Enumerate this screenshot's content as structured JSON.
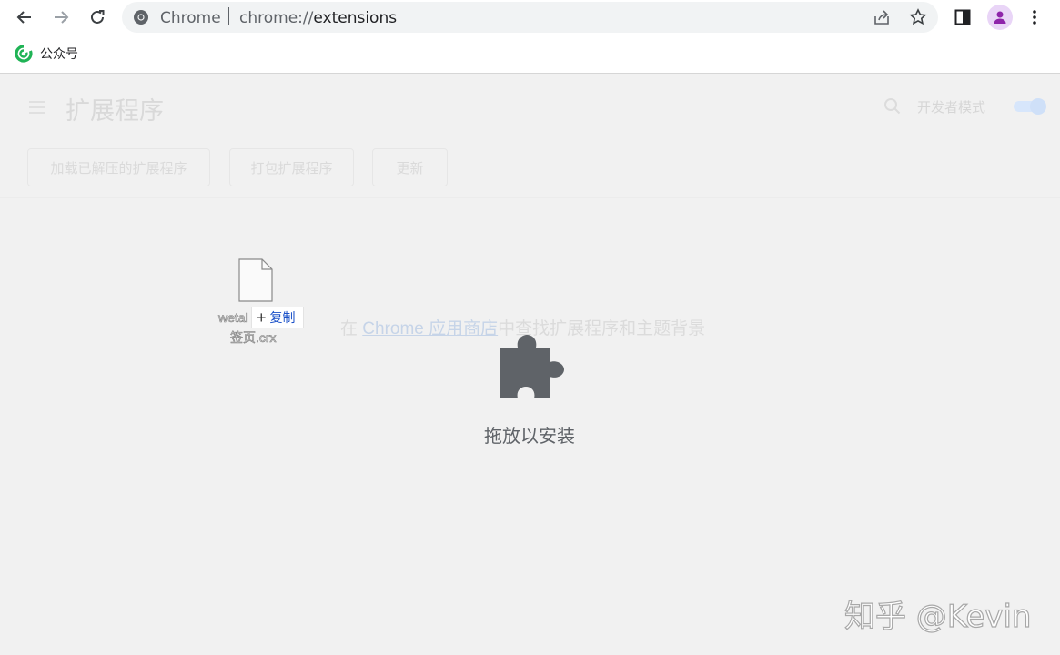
{
  "browser": {
    "omnibox": {
      "host": "Chrome",
      "url_prefix": "chrome://",
      "url_path": "extensions"
    },
    "bookmarks": [
      {
        "label": "公众号"
      }
    ]
  },
  "extensions_page": {
    "title": "扩展程序",
    "developer_mode_label": "开发者模式",
    "developer_mode_on": true,
    "buttons": {
      "load_unpacked": "加载已解压的扩展程序",
      "pack": "打包扩展程序",
      "update": "更新"
    },
    "store_prefix": "在 ",
    "store_link": "Chrome 应用商店",
    "store_suffix": "中查找扩展程序和主题背景"
  },
  "drop_overlay": {
    "label": "拖放以安装",
    "icon": "puzzle-piece-icon"
  },
  "drag_file": {
    "name_line1": "wetal",
    "name_line2": "签页.crx",
    "copy_label": "复制"
  },
  "watermark": "知乎 @Kevin",
  "colors": {
    "accent": "#1a73e8",
    "avatar_bg": "#e9d5f7",
    "avatar_fg": "#8e24aa",
    "puzzle": "#5f6368"
  }
}
